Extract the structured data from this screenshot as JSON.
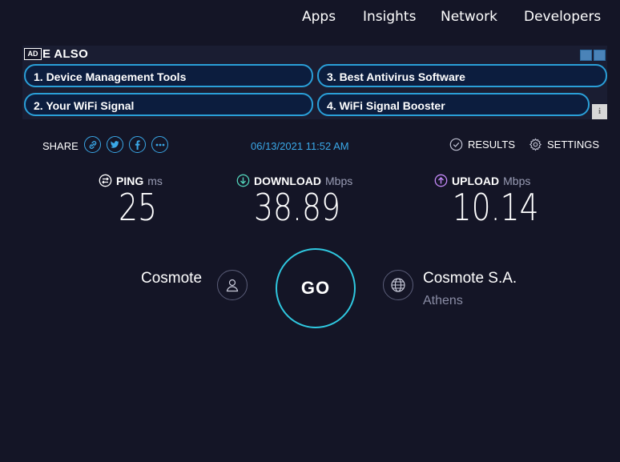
{
  "nav": {
    "apps": "Apps",
    "insights": "Insights",
    "network": "Network",
    "developers": "Developers"
  },
  "ad": {
    "badge": "AD",
    "heading": "E ALSO",
    "items": [
      "1.  Device Management Tools",
      "3.  Best Antivirus Software",
      "2.  Your WiFi Signal",
      "4.  WiFi Signal Booster"
    ],
    "info_glyph": "i",
    "accent_color": "#2a9fd8"
  },
  "share": {
    "label": "SHARE",
    "icons": [
      "link-icon",
      "twitter-icon",
      "facebook-icon",
      "more-icon"
    ]
  },
  "timestamp": "06/13/2021 11:52 AM",
  "actions": {
    "results": "RESULTS",
    "settings": "SETTINGS"
  },
  "metrics": {
    "ping": {
      "label": "PING",
      "unit": "ms",
      "value": "25",
      "icon": "ping-icon"
    },
    "download": {
      "label": "DOWNLOAD",
      "unit": "Mbps",
      "value": "38.89",
      "icon": "download-arrow-icon",
      "color": "#52d1b8"
    },
    "upload": {
      "label": "UPLOAD",
      "unit": "Mbps",
      "value": "10.14",
      "icon": "upload-arrow-icon",
      "color": "#c58af9"
    }
  },
  "provider": {
    "isp": "Cosmote",
    "server": "Cosmote S.A.",
    "city": "Athens"
  },
  "go_label": "GO",
  "colors": {
    "background": "#141526",
    "accent_blue": "#3aa8e8",
    "go_ring": "#2fc8e0"
  }
}
